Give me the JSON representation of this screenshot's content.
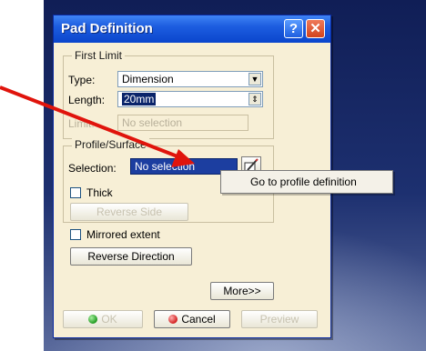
{
  "dialog": {
    "title": "Pad Definition",
    "help_glyph": "?",
    "close_glyph": "✕"
  },
  "first_limit": {
    "legend": "First Limit",
    "type_label": "Type:",
    "type_value": "Dimension",
    "length_label": "Length:",
    "length_value": "20mm",
    "limit_label": "Limit:",
    "limit_value": "No selection"
  },
  "profile": {
    "legend": "Profile/Surface",
    "selection_label": "Selection:",
    "selection_value": "No selection",
    "thick_label": "Thick",
    "reverse_side_label": "Reverse Side"
  },
  "mirrored_label": "Mirrored extent",
  "reverse_direction_label": "Reverse Direction",
  "more_label": "More>>",
  "buttons": {
    "ok": "OK",
    "cancel": "Cancel",
    "preview": "Preview"
  },
  "popup": {
    "label": "Go to profile definition"
  },
  "colors": {
    "title_bar": "#1d5de0",
    "dialog_bg": "#f7efd6",
    "pointer_arrow": "#e0140c",
    "ok_dot": "#1f9a1f",
    "cancel_dot": "#d21e1e"
  }
}
